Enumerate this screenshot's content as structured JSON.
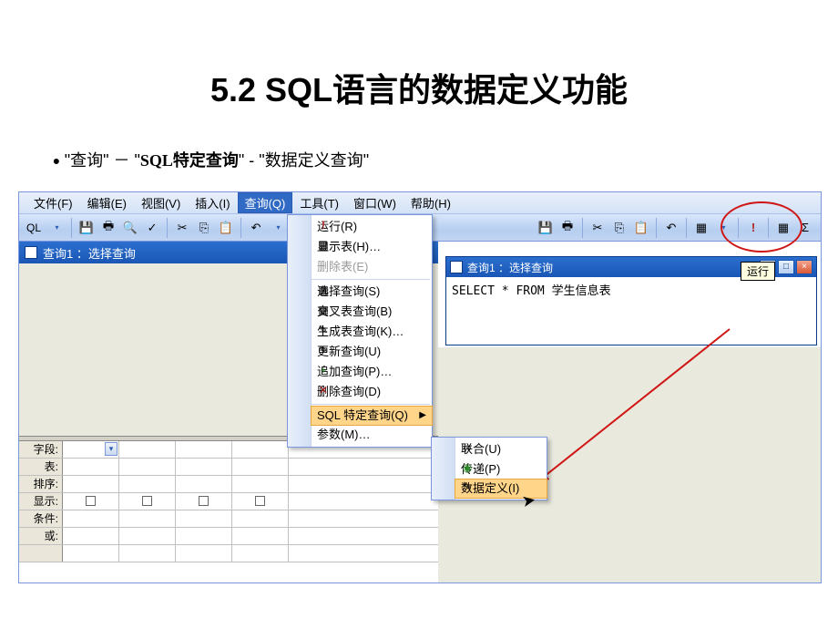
{
  "slide": {
    "title": "5.2   SQL语言的数据定义功能",
    "nav_path": {
      "q1": "查询",
      "sep1": "－",
      "q2": "SQL特定查询",
      "sep2": "-",
      "q3": "数据定义查询"
    }
  },
  "menubar": {
    "file": "文件(F)",
    "edit": "编辑(E)",
    "view": "视图(V)",
    "insert": "插入(I)",
    "query": "查询(Q)",
    "tools": "工具(T)",
    "window": "窗口(W)",
    "help": "帮助(H)"
  },
  "toolbar": {
    "sql_label": "QL",
    "run_tooltip": "运行",
    "right_greek": "Σ"
  },
  "design_window": {
    "title": "查询1 ：选择查询",
    "row_labels": [
      "字段:",
      "表:",
      "排序:",
      "显示:",
      "条件:",
      "或:"
    ]
  },
  "dropdown": {
    "items": [
      {
        "label": "运行",
        "hotkey": "(R)",
        "icon": "!",
        "disabled": false
      },
      {
        "label": "显示表",
        "hotkey": "(H)",
        "suffix": "…",
        "icon": "▦"
      },
      {
        "label": "删除表",
        "hotkey": "(E)",
        "disabled": true
      },
      {
        "sep": true
      },
      {
        "label": "选择查询",
        "hotkey": "(S)",
        "icon": "▦"
      },
      {
        "label": "交叉表查询",
        "hotkey": "(B)",
        "icon": "▦"
      },
      {
        "label": "生成表查询",
        "hotkey": "(K)",
        "suffix": "…",
        "icon": "✎"
      },
      {
        "label": "更新查询",
        "hotkey": "(U)",
        "icon": "✎"
      },
      {
        "label": "追加查询",
        "hotkey": "(P)",
        "suffix": "…",
        "icon": "+"
      },
      {
        "label": "删除查询",
        "hotkey": "(D)",
        "icon": "✕"
      },
      {
        "sep": true
      },
      {
        "label": "SQL 特定查询",
        "hotkey": "(Q)",
        "arrow": true,
        "hover": true
      },
      {
        "label": "参数",
        "hotkey": "(M)",
        "suffix": "…"
      }
    ]
  },
  "submenu": {
    "items": [
      {
        "label": "联合",
        "hotkey": "(U)",
        "icon": "∞"
      },
      {
        "label": "传递",
        "hotkey": "(P)",
        "icon": "◉"
      },
      {
        "label": "数据定义",
        "hotkey": "(I)",
        "icon": "✎",
        "hover": true
      }
    ]
  },
  "sql_window": {
    "title": "查询1 ：选择查询",
    "body": "SELECT * FROM 学生信息表"
  }
}
